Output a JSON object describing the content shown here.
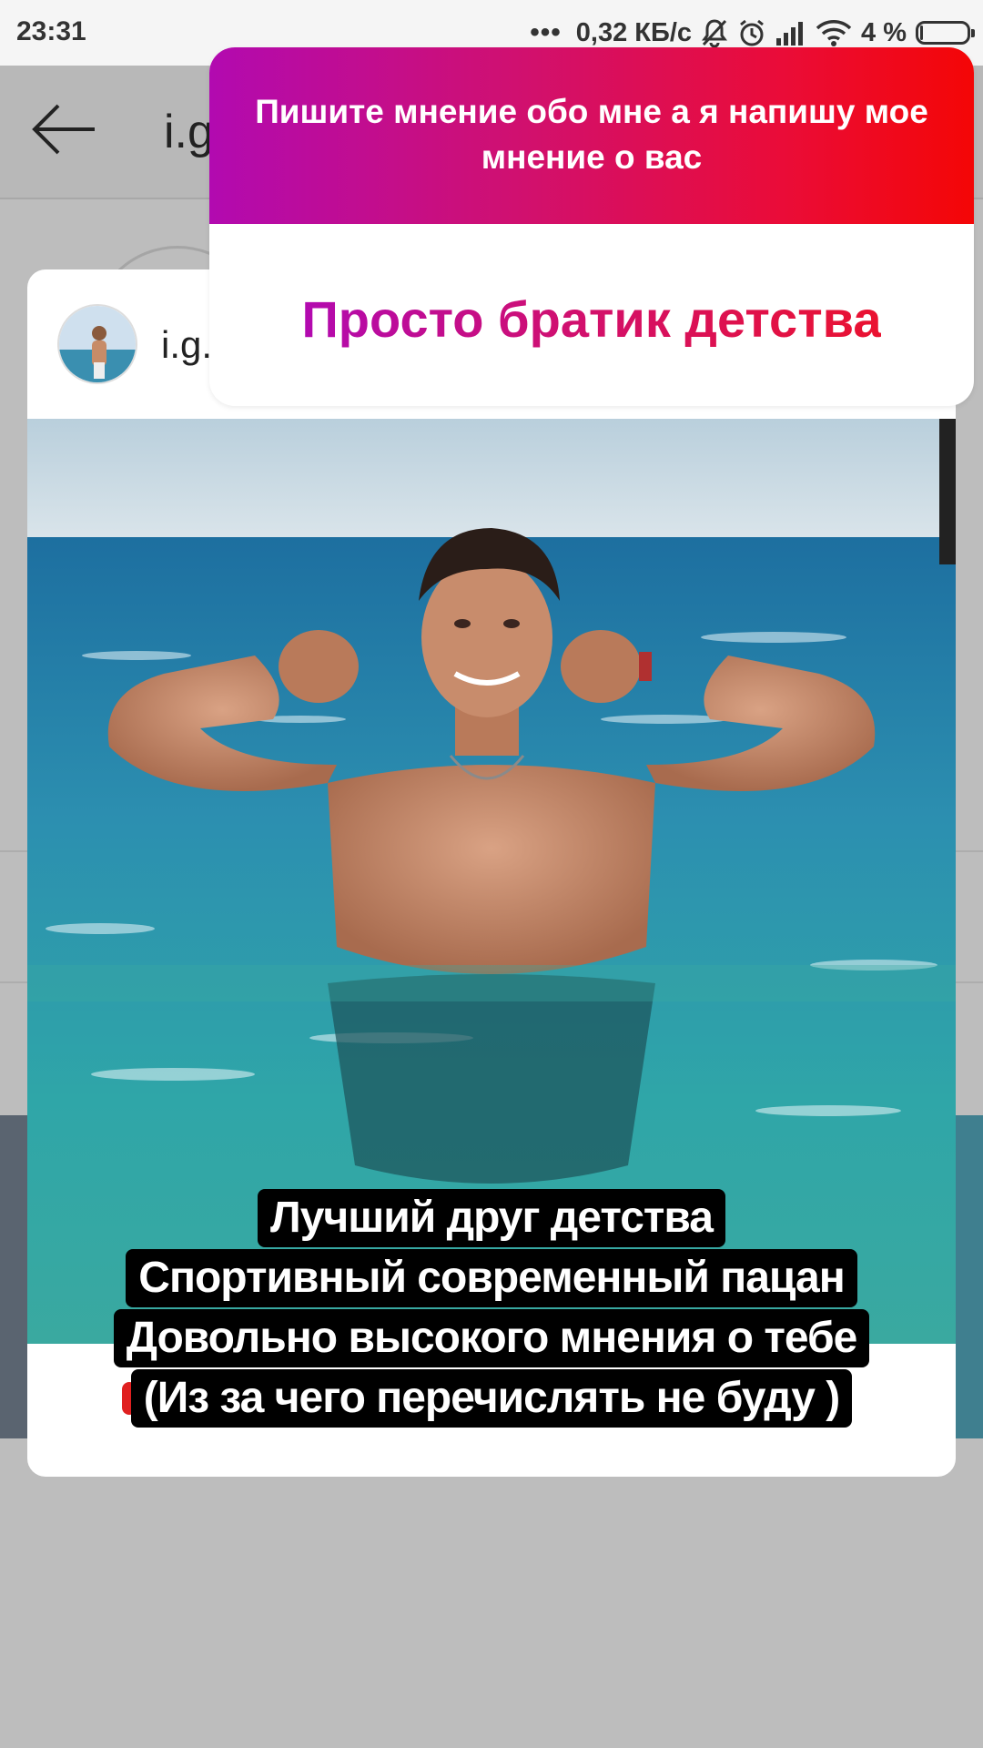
{
  "status_bar": {
    "time": "23:31",
    "dots": "•••",
    "speed": "0,32 КБ/с",
    "battery_pct": "4 %",
    "battery_level": 0.04,
    "icons": [
      "bell-off-icon",
      "alarm-icon",
      "signal-icon",
      "wifi-icon",
      "battery-icon"
    ]
  },
  "background_app": {
    "title": "i.g."
  },
  "story": {
    "username": "i.g.",
    "sticker": {
      "question": "Пишите мнение обо мне а я напишу мое мнение о вас",
      "answer": "Просто братик детства"
    },
    "caption_lines": [
      "Лучший друг детства",
      "Спортивный современный пацан",
      "Довольно высокого мнения о тебе",
      "(Из за чего перечислять не буду )"
    ]
  },
  "colors": {
    "sticker_gradient_start": "#b20ab0",
    "sticker_gradient_end": "#f40606",
    "overlay": "#bdbdbd"
  }
}
